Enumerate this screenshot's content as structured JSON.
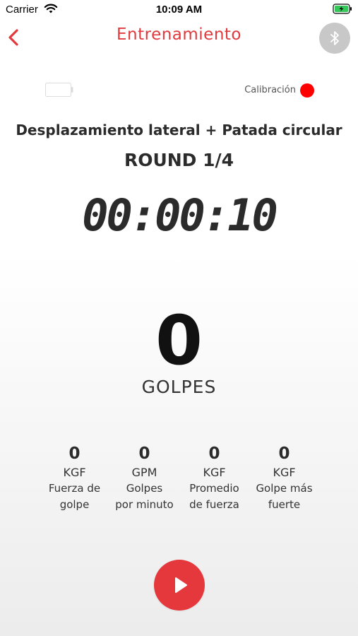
{
  "status_bar": {
    "carrier": "Carrier",
    "time": "10:09 AM"
  },
  "nav": {
    "title": "Entrenamiento",
    "back_icon": "chevron-left-icon",
    "bluetooth_icon": "bluetooth-icon"
  },
  "sensor": {
    "calibration_label": "Calibración",
    "calibration_status_color": "#ff0000"
  },
  "workout": {
    "exercise": "Desplazamiento lateral + Patada circular",
    "round": "ROUND 1/4",
    "timer": "00:00:10",
    "hits": "0",
    "hits_label": "GOLPES"
  },
  "stats": [
    {
      "value": "0",
      "unit": "KGF",
      "desc1": "Fuerza de",
      "desc2": "golpe"
    },
    {
      "value": "0",
      "unit": "GPM",
      "desc1": "Golpes",
      "desc2": "por minuto"
    },
    {
      "value": "0",
      "unit": "KGF",
      "desc1": "Promedio",
      "desc2": "de fuerza"
    },
    {
      "value": "0",
      "unit": "KGF",
      "desc1": "Golpe más",
      "desc2": "fuerte"
    }
  ],
  "colors": {
    "accent": "#e03a3e",
    "play": "#e5383c",
    "battery_green": "#34c759"
  }
}
